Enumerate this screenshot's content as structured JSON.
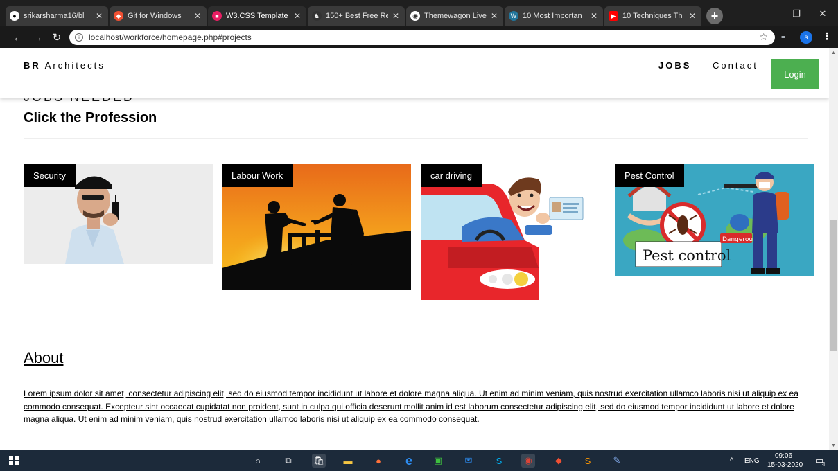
{
  "browser": {
    "tabs": [
      {
        "title": "srikarsharma16/bl",
        "favicon": "github-icon",
        "color": "#ffffff"
      },
      {
        "title": "Git for Windows",
        "favicon": "git-icon",
        "color": "#f05033"
      },
      {
        "title": "W3.CSS Template",
        "favicon": "w3css-icon",
        "color": "#e91e63"
      },
      {
        "title": "150+ Best Free Re",
        "favicon": "horse-icon",
        "color": "#333333"
      },
      {
        "title": "Themewagon Live",
        "favicon": "globe-icon",
        "color": "#555555"
      },
      {
        "title": "10 Most Importan",
        "favicon": "wordpress-icon",
        "color": "#21759b"
      },
      {
        "title": "10 Techniques Th",
        "favicon": "youtube-icon",
        "color": "#ff0000"
      }
    ],
    "url": "localhost/workforce/homepage.php#projects",
    "profile_initial": "s"
  },
  "site": {
    "brand_bold": "BR",
    "brand_rest": " Architects",
    "nav_jobs": "JOBS",
    "nav_contact": "Contact",
    "login": "Login"
  },
  "jobs": {
    "heading_partial": "JOBS NEEDED",
    "title": "Click the Profession",
    "cards": [
      {
        "label": "Security"
      },
      {
        "label": "Labour Work"
      },
      {
        "label": "car driving"
      },
      {
        "label": "Pest Control",
        "sign_text": "Pest control",
        "badge_text": "Dangerous"
      }
    ]
  },
  "about": {
    "title": "About",
    "text": "Lorem ipsum dolor sit amet, consectetur adipiscing elit, sed do eiusmod tempor incididunt ut labore et dolore magna aliqua. Ut enim ad minim veniam, quis nostrud exercitation ullamco laboris nisi ut aliquip ex ea commodo consequat. Excepteur sint occaecat cupidatat non proident, sunt in culpa qui officia deserunt mollit anim id est laborum consectetur adipiscing elit, sed do eiusmod tempor incididunt ut labore et dolore magna aliqua. Ut enim ad minim veniam, quis nostrud exercitation ullamco laboris nisi ut aliquip ex ea commodo consequat."
  },
  "taskbar": {
    "lang": "ENG",
    "time": "09:06",
    "date": "15-03-2020",
    "notification_count": "4"
  },
  "colors": {
    "accent_green": "#4caf50",
    "label_bg": "#000000",
    "taskbar_bg": "#1c2a3a"
  }
}
